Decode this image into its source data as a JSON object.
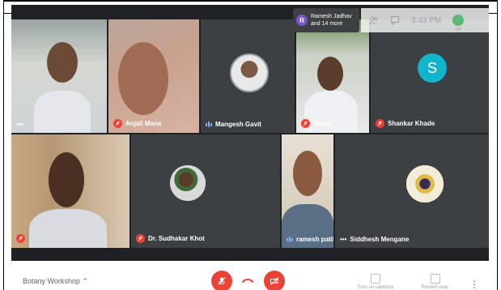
{
  "meeting": {
    "title": "Botany Workshop",
    "time": "3:43 PM",
    "you_label": "you"
  },
  "participants_chip": {
    "initial": "R",
    "line1": "Ramesh Jadhav",
    "line2": "and 14 more"
  },
  "tiles": [
    {
      "name": "",
      "muted": false
    },
    {
      "name": "Anjali Mane",
      "muted": true
    },
    {
      "name": "Mangesh Gavit",
      "muted": false,
      "speaking": true
    },
    {
      "name": "Vikas",
      "muted": true
    },
    {
      "name": "Shankar Khade",
      "muted": true,
      "initial": "S"
    },
    {
      "name": "",
      "muted": true
    },
    {
      "name": "Dr. Sudhakar Khot",
      "muted": true
    },
    {
      "name": "ramesh patil",
      "muted": false,
      "speaking": true
    },
    {
      "name": "Siddhesh Mengane",
      "muted": false
    }
  ],
  "controls": {
    "captions_label": "Turn on captions",
    "present_label": "Present now"
  },
  "colors": {
    "background": "#202124",
    "tile": "#3c4043",
    "danger": "#ea4335",
    "accent_teal": "#12b5cb"
  }
}
